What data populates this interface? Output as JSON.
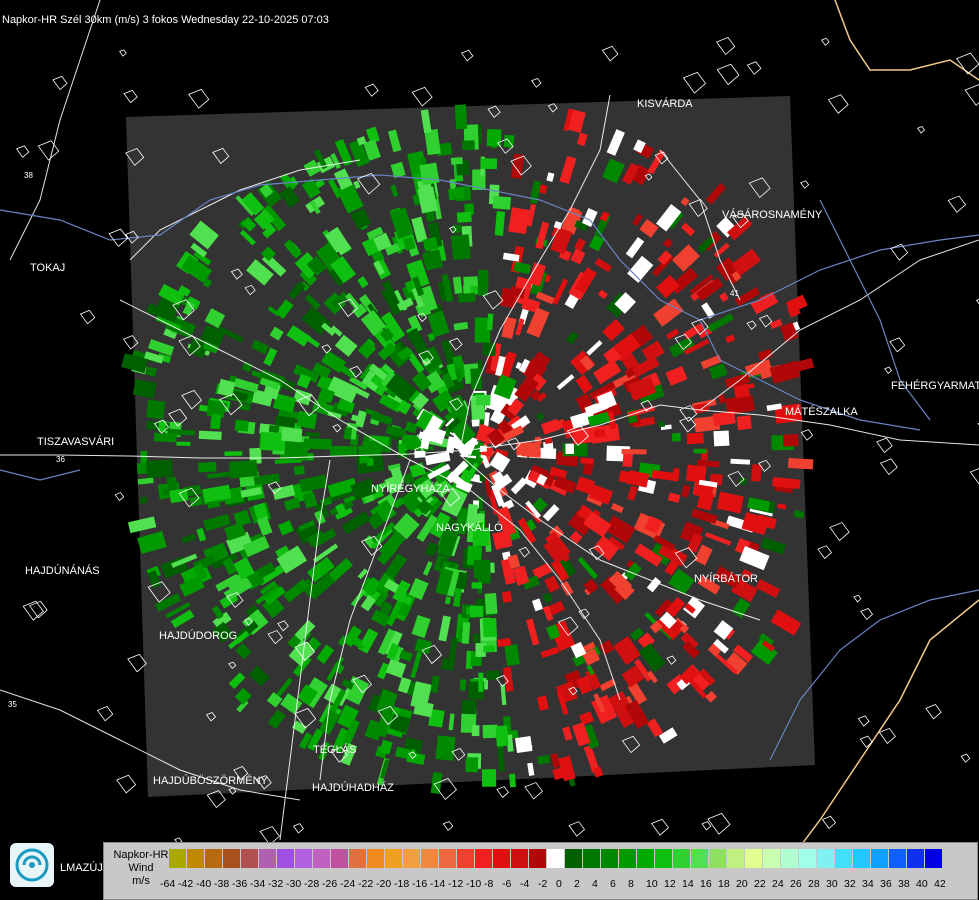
{
  "title": "Napkor-HR Szél 30km (m/s) 3 fokos Wednesday 22-10-2025 07:03",
  "colors": {
    "background": "#000000",
    "radar_area": "#333333",
    "admin_lines": "#ffffff",
    "rivers": "#6a84c4",
    "border": "#f2c98a"
  },
  "cities": [
    {
      "name": "KISVÁRDA"
    },
    {
      "name": "TOKAJ"
    },
    {
      "name": "VÁSÁROSNAMÉNY"
    },
    {
      "name": "FEHÉRGYARMAT"
    },
    {
      "name": "MÁTÉSZALKA"
    },
    {
      "name": "TISZAVASVÁRI"
    },
    {
      "name": "NYÍREGYHÁZA"
    },
    {
      "name": "NAGYKÁLLÓ"
    },
    {
      "name": "HAJDÚNÁNÁS"
    },
    {
      "name": "NYÍRBÁTOR"
    },
    {
      "name": "HAJDÚDOROG"
    },
    {
      "name": "TÉGLÁS"
    },
    {
      "name": "HAJDÚBÖSZÖRMÉNY"
    },
    {
      "name": "HAJDÚHADHÁZ"
    }
  ],
  "road_labels": [
    "38",
    "36",
    "35",
    "41"
  ],
  "legend": {
    "line1": "Napkor-HR",
    "line2": "Wind",
    "line3": "m/s",
    "ticks": [
      "-64",
      "-42",
      "-40",
      "-38",
      "-36",
      "-34",
      "-32",
      "-30",
      "-28",
      "-26",
      "-24",
      "-22",
      "-20",
      "-18",
      "-16",
      "-14",
      "-12",
      "-10",
      "-8",
      "-6",
      "-4",
      "-2",
      "0",
      "2",
      "4",
      "6",
      "8",
      "10",
      "12",
      "14",
      "16",
      "18",
      "20",
      "22",
      "24",
      "26",
      "28",
      "30",
      "32",
      "34",
      "36",
      "38",
      "40",
      "42"
    ],
    "colors": [
      "#a8a800",
      "#c08a00",
      "#b86a10",
      "#a85020",
      "#b05050",
      "#b060b0",
      "#a050e0",
      "#b060e0",
      "#c060c0",
      "#c050a0",
      "#e07040",
      "#f08a20",
      "#f0a020",
      "#f0a040",
      "#f08840",
      "#f06840",
      "#f04030",
      "#f02020",
      "#e01010",
      "#d01010",
      "#b00808",
      "#ffffff",
      "#006000",
      "#007800",
      "#008800",
      "#009a00",
      "#00aa00",
      "#10c010",
      "#30d030",
      "#50e050",
      "#90e060",
      "#c0f080",
      "#e0ff90",
      "#c8ffb0",
      "#b0ffd0",
      "#a0ffe8",
      "#80f0f0",
      "#40e0f8",
      "#20c8ff",
      "#10a0ff",
      "#1060ff",
      "#1030f0",
      "#0000e0"
    ]
  },
  "logo": {
    "text": "LMAZÚJVÁR"
  }
}
